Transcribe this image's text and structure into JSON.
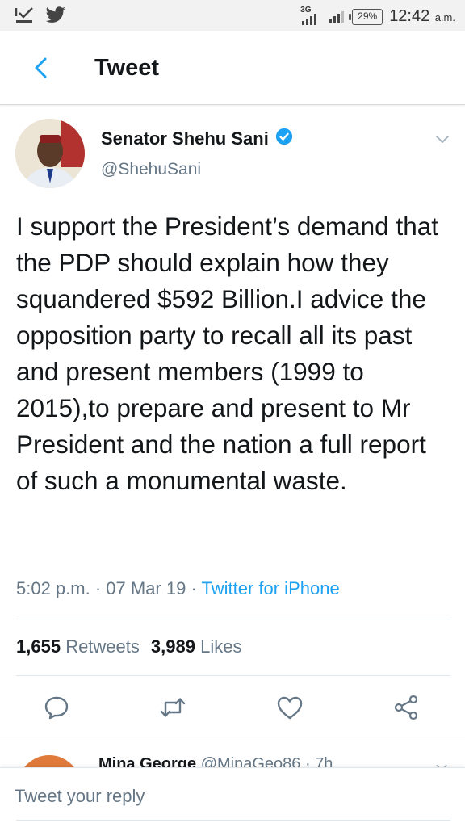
{
  "status_bar": {
    "network": "3G",
    "battery": "29%",
    "time": "12:42",
    "ampm": "a.m."
  },
  "header": {
    "title": "Tweet"
  },
  "tweet": {
    "author_name": "Senator Shehu Sani",
    "handle": "@ShehuSani",
    "text": "I support the President’s demand that the PDP should explain how they squandered $592 Billion.I advice the opposition party to recall all its past and present members (1999 to 2015),to prepare and present to Mr President and the nation a full report of such a monumental waste.",
    "time": "5:02 p.m.",
    "date": "07 Mar 19",
    "source": "Twitter for iPhone",
    "retweets_count": "1,655",
    "retweets_label": "Retweets",
    "likes_count": "3,989",
    "likes_label": "Likes"
  },
  "reply_peek": {
    "name": "Mina George",
    "handle": "@MinaGeo86",
    "age": "7h"
  },
  "reply_box": {
    "placeholder": "Tweet your reply"
  },
  "colors": {
    "accent": "#1da1f2",
    "secondary_text": "#657786",
    "primary_text": "#14171a"
  },
  "icons": {
    "status_left": [
      "download-check-icon",
      "twitter-bird-icon"
    ],
    "actions": [
      "reply-icon",
      "retweet-icon",
      "like-icon",
      "share-icon"
    ]
  }
}
